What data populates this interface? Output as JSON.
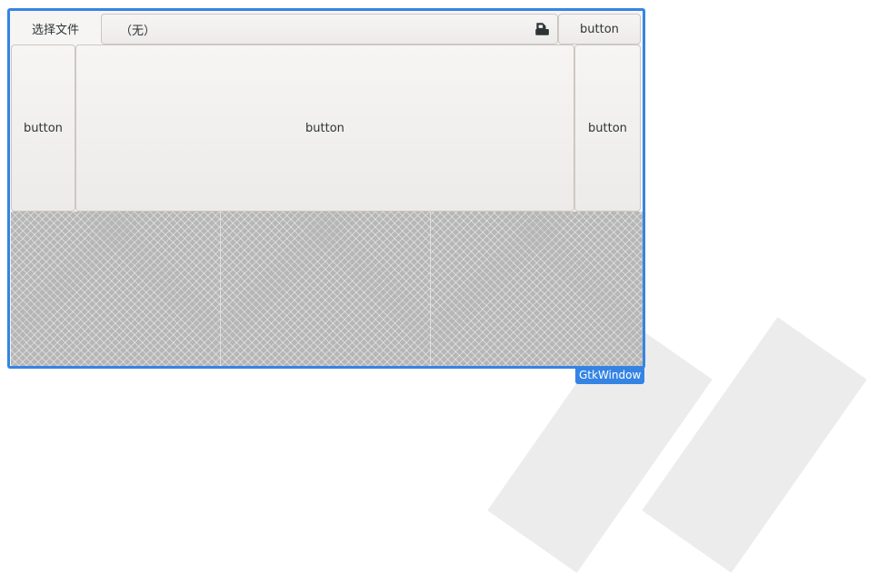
{
  "toolbar": {
    "choose_file_label": "选择文件",
    "file_value": "（无）",
    "file_icon": "document-open-icon",
    "right_button_label": "button"
  },
  "middle_row": {
    "left_button_label": "button",
    "center_button_label": "button",
    "right_button_label": "button"
  },
  "window": {
    "class_label": "GtkWindow",
    "border_color": "#3584e4"
  }
}
